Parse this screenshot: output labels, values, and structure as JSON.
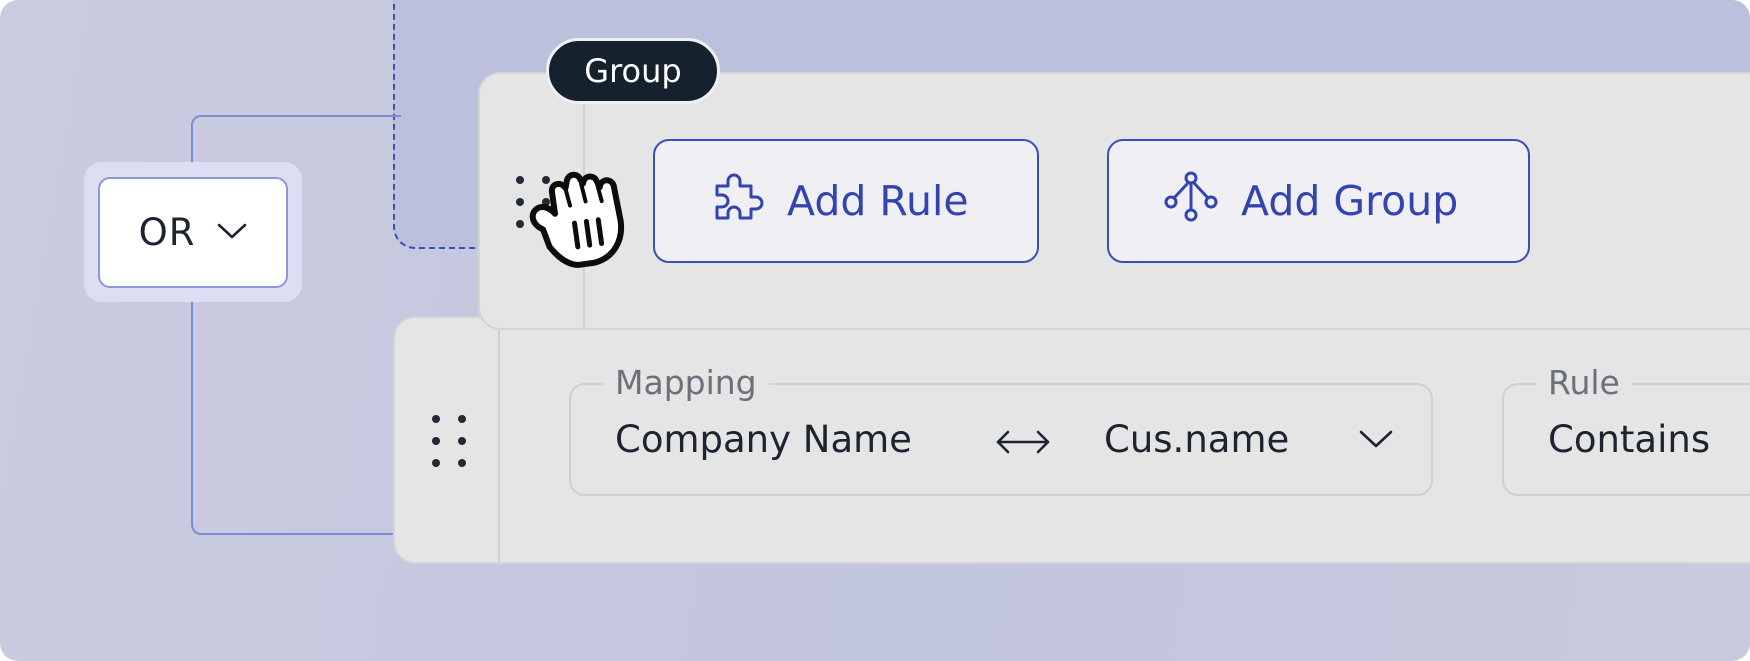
{
  "operator": {
    "value": "OR",
    "icon": "chevron-down-icon"
  },
  "group": {
    "badge_label": "Group",
    "add_rule_label": "Add Rule",
    "add_rule_icon": "puzzle-piece-icon",
    "add_group_label": "Add Group",
    "add_group_icon": "branch-icon"
  },
  "rule": {
    "mapping": {
      "legend": "Mapping",
      "left_value": "Company Name",
      "right_value": "Cus.name",
      "link_icon": "bidirectional-arrow-icon"
    },
    "condition": {
      "legend": "Rule",
      "value": "Contains"
    }
  },
  "cursor": "grab-hand-icon",
  "colors": {
    "accent": "#3344b0",
    "badge_bg": "#15212d",
    "card_bg": "#e5e5e6",
    "canvas_bg": "#c5c8df",
    "connector": "#7f8ad2"
  }
}
